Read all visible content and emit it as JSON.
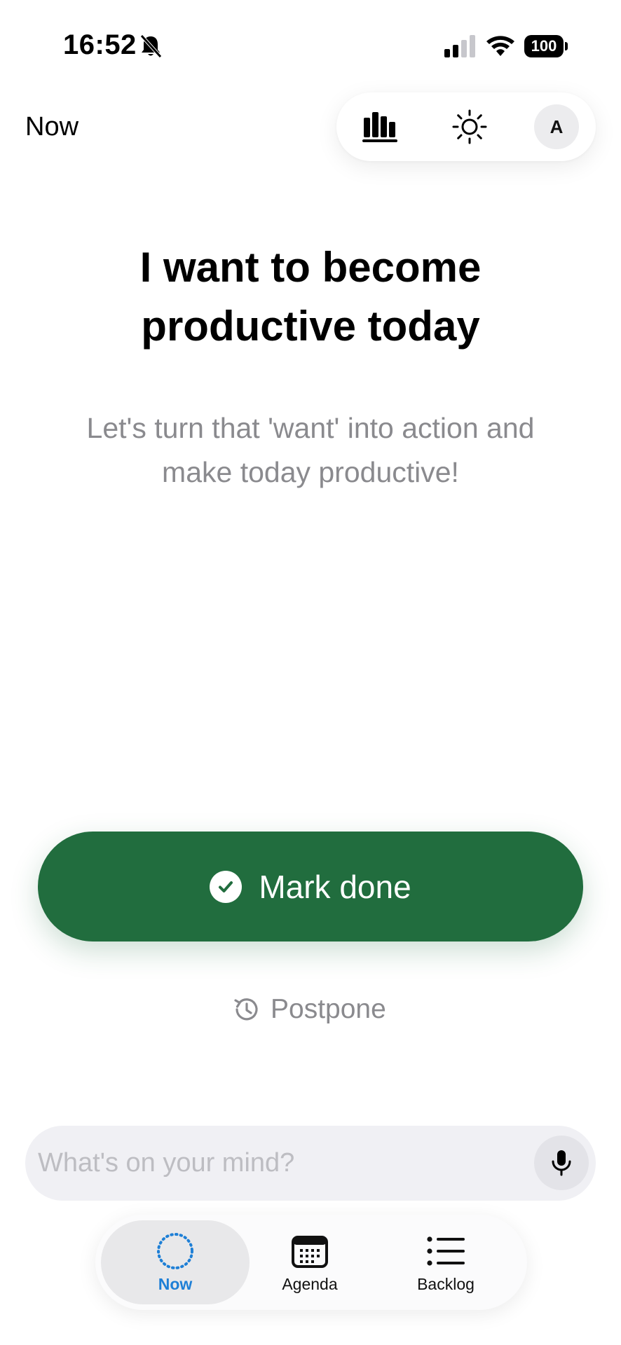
{
  "status_bar": {
    "time": "16:52",
    "battery": "100",
    "icons": [
      "bell-slash-icon",
      "signal-icon",
      "wifi-icon",
      "battery-icon"
    ]
  },
  "header": {
    "title": "Now",
    "buttons": [
      "stats-icon",
      "sun-icon"
    ],
    "avatar_initial": "A"
  },
  "task": {
    "title": "I want to become productive today",
    "subtitle": "Let's turn that 'want' into action and make today productive!"
  },
  "actions": {
    "mark_done_label": "Mark done",
    "postpone_label": "Postpone"
  },
  "input": {
    "placeholder": "What's on your mind?",
    "value": ""
  },
  "tabs": [
    {
      "label": "Now",
      "icon": "dotted-circle-icon",
      "active": true
    },
    {
      "label": "Agenda",
      "icon": "calendar-icon",
      "active": false
    },
    {
      "label": "Backlog",
      "icon": "list-icon",
      "active": false
    }
  ],
  "colors": {
    "primary_green": "#216d3e",
    "active_tab_blue": "#1e7fd6",
    "muted_text": "#8a8a8e"
  }
}
